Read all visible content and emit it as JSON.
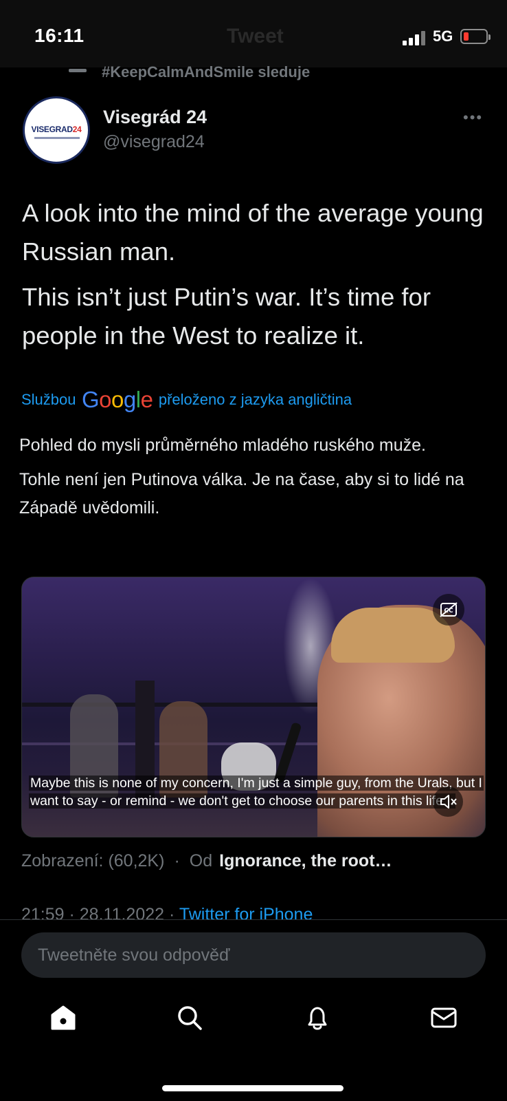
{
  "status_bar": {
    "time": "16:11",
    "network": "5G",
    "header_title_ghost": "Tweet"
  },
  "social_context": {
    "text": "#KeepCalmAndSmile sleduje"
  },
  "author": {
    "avatar_logo_main": "VISEGRAD",
    "avatar_logo_accent": "24",
    "name": "Visegrád 24",
    "handle": "@visegrad24"
  },
  "tweet": {
    "paragraphs": [
      "A look into the mind of the average young Russian man.",
      "This isn’t just Putin’s war. It’s time for people in the West to realize it."
    ]
  },
  "translation": {
    "prefix": "Službou",
    "provider_logo_letters": [
      "G",
      "o",
      "o",
      "g",
      "l",
      "e"
    ],
    "suffix": "přeloženo z jazyka angličtina",
    "paragraphs": [
      "Pohled do mysli průměrného mladého ruského muže.",
      "Tohle není jen Putinova válka. Je na čase, aby si to lidé na Západě uvědomili."
    ]
  },
  "video": {
    "caption": "Maybe this is none of my concern, I'm just a simple guy, from the Urals, but I want to say - or remind - we don't get to choose our parents in this life...",
    "cc_icon": "closed-captions-icon",
    "mute_icon": "muted-speaker-icon"
  },
  "meta": {
    "views": "Zobrazení: (60,2K)",
    "separator": "·",
    "source_prefix": "Od",
    "source": "Ignorance, the root…",
    "timestamp": "21:59 · 28.11.2022 · ",
    "app": "Twitter for iPhone"
  },
  "composer": {
    "placeholder": "Tweetněte svou odpověď"
  },
  "tabbar": {
    "items": [
      "home-icon",
      "search-icon",
      "notifications-icon",
      "messages-icon"
    ]
  },
  "colors": {
    "background": "#000000",
    "text": "#e7e9ea",
    "muted": "#71767b",
    "link": "#1d9bf0"
  }
}
